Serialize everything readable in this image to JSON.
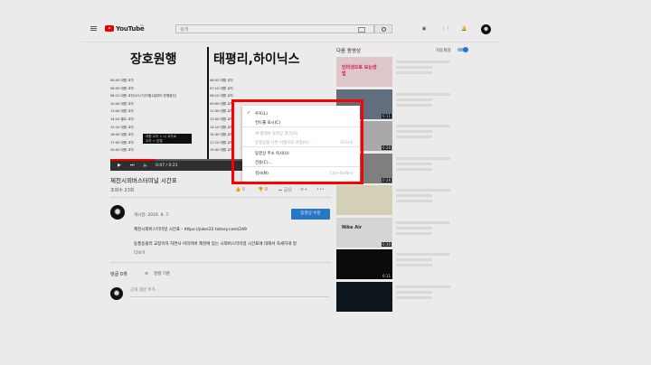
{
  "header": {
    "logo_text": "YouTube",
    "logo_region": "KR",
    "search_placeholder": "검색",
    "icons": [
      "menu-icon",
      "search-icon",
      "create-video-icon",
      "apps-icon",
      "notifications-icon"
    ]
  },
  "video": {
    "heading_left": "장호원행",
    "heading_right": "태평리,하이닉스",
    "schedule_left": [
      "06:40 대원 교차",
      "06:50 대원 교차",
      "08:10 대원 교차(2017년2월1일부터 운행중단)",
      "10:40 대원 교차",
      "13:40 대원 교차",
      "14:20 콜트 교차",
      "15:20 대원 교차",
      "16:40 대원 교차",
      "17:50 대원 교차",
      "20:00 대원 교차"
    ],
    "schedule_right": [
      "06:45 대원 교차",
      "07:10 대원 교차",
      "08:10 대원 교차",
      "09:00 대원 교차",
      "11:00 대원 교차",
      "12:00 대원 교차",
      "14:10 대원 교차",
      "15:40 대원 교차",
      "17:10 대원 교차",
      "19:40 대원 교차"
    ],
    "panel_line1": "대원 교차 = 나 교차로",
    "panel_line2": "교차 = 호텔",
    "time": "0:07 / 0:21",
    "progress": 0.22,
    "title": "제천시외버스터미널 시간표",
    "views": "조회수 23회",
    "likes": "0",
    "dislikes": "0",
    "share": "공유",
    "actions_more": "•••"
  },
  "owner": {
    "published": "게시일: 2016. 8. 7.",
    "edit_button": "동영상 수정",
    "description_line1": "제천시외버스터미널 시간표 - https://joker22.tistory.com/249",
    "description_line2": "동풍동플러 교장이자 자연사 아리카버 제천에 있는 시외버스터미널 시간표에 대해서 자세하게 정",
    "more_link": "더보기"
  },
  "comments": {
    "count": "댓글 0개",
    "sort": "정렬 기준",
    "input_placeholder": "공개 댓글 추가..."
  },
  "sidebar": {
    "heading": "다음 동영상",
    "autoplay_label": "자동재생",
    "autoplay_on": true,
    "thumbs": [
      {
        "text": "인터넷으로 보는방법",
        "duration": ""
      },
      {
        "text": "",
        "duration": "0:11"
      },
      {
        "text": "",
        "duration": "0:28"
      },
      {
        "text": "",
        "duration": "0:28"
      },
      {
        "text": "",
        "duration": ""
      },
      {
        "text": "Nike Air",
        "duration": "0:30"
      },
      {
        "text": "",
        "duration": "0:11"
      },
      {
        "text": "",
        "duration": ""
      }
    ]
  },
  "context_menu": {
    "items": [
      {
        "label": "루프(L)",
        "checked": true,
        "disabled": false,
        "shortcut": ""
      },
      {
        "label": "컨트롤 표시(C)",
        "checked": false,
        "disabled": false,
        "shortcut": ""
      },
      {
        "label": "새 탭에서 동영상 열기(O)",
        "checked": false,
        "disabled": true,
        "shortcut": ""
      },
      {
        "label": "동영상을 다른 이름으로 저장(V)...",
        "checked": false,
        "disabled": true,
        "shortcut": "Ctrl+S"
      },
      {
        "label": "동영상 주소 복사(U)",
        "checked": false,
        "disabled": false,
        "shortcut": ""
      },
      {
        "label": "전송(C)...",
        "checked": false,
        "disabled": false,
        "shortcut": ""
      },
      {
        "label": "검사(N)",
        "checked": false,
        "disabled": false,
        "shortcut": "Ctrl+Shift+I"
      }
    ]
  },
  "colors": {
    "highlight": "#ff0000",
    "accent": "#2a82d6",
    "brand": "#ff0000"
  }
}
